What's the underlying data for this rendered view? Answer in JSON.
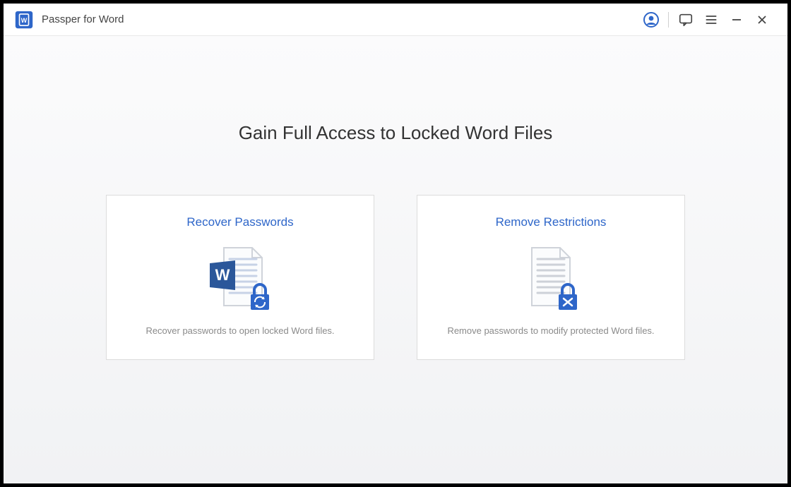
{
  "app": {
    "title": "Passper for Word"
  },
  "main": {
    "headline": "Gain Full Access to Locked Word Files",
    "cards": [
      {
        "title": "Recover Passwords",
        "desc": "Recover passwords to open locked Word files."
      },
      {
        "title": "Remove Restrictions",
        "desc": "Remove passwords to modify protected Word files."
      }
    ]
  },
  "colors": {
    "brand_blue": "#2e66c9",
    "text_gray": "#8a8a8a"
  }
}
